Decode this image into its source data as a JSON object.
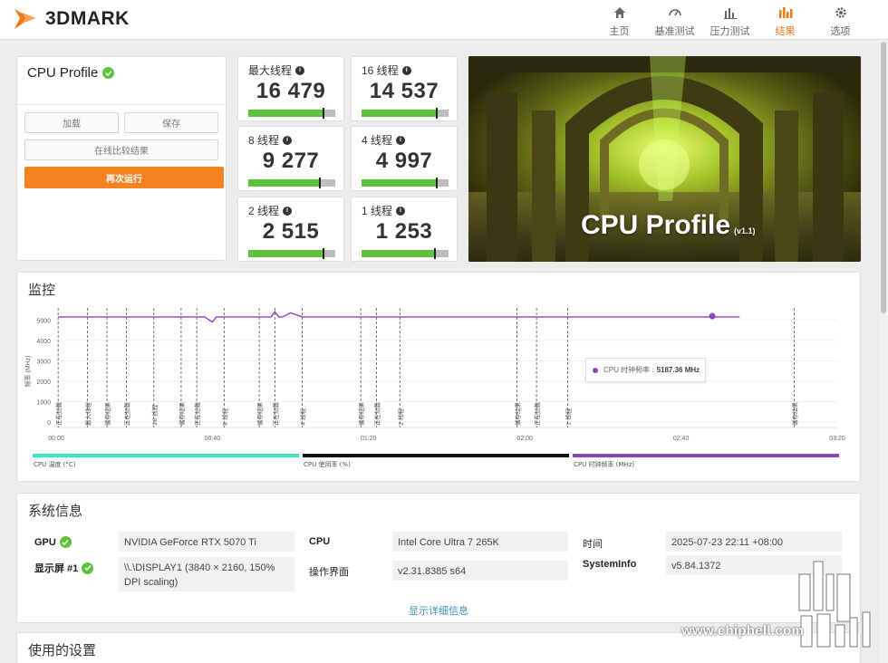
{
  "app": {
    "logo_text": "3DMARK"
  },
  "nav": [
    {
      "label": "主页",
      "icon": "home-icon"
    },
    {
      "label": "基准测试",
      "icon": "gauge-icon"
    },
    {
      "label": "压力测试",
      "icon": "bar-chart-icon"
    },
    {
      "label": "结果",
      "icon": "results-icon",
      "active": true
    },
    {
      "label": "选项",
      "icon": "gear-icon"
    }
  ],
  "profile": {
    "title": "CPU Profile",
    "load_label": "加载",
    "save_label": "保存",
    "compare_label": "在线比较结果",
    "rerun_label": "再次运行"
  },
  "scores": [
    {
      "label": "最大线程",
      "value": "16 479",
      "fill": 0.86
    },
    {
      "label": "16 线程",
      "value": "14 537",
      "fill": 0.86
    },
    {
      "label": "8 线程",
      "value": "9 277",
      "fill": 0.82
    },
    {
      "label": "4 线程",
      "value": "4 997",
      "fill": 0.86
    },
    {
      "label": "2 线程",
      "value": "2 515",
      "fill": 0.86
    },
    {
      "label": "1 线程",
      "value": "1 253",
      "fill": 0.84
    }
  ],
  "hero": {
    "title": "CPU Profile",
    "version": "(v1.1)"
  },
  "monitor": {
    "title": "监控",
    "tooltip_label": "CPU 时钟频率 :",
    "tooltip_value": "5187.36 MHz",
    "legend": [
      {
        "label": "CPU 温度 (°C)",
        "color": "#3ee6c1"
      },
      {
        "label": "CPU 使用率 (%)",
        "color": "#111111"
      },
      {
        "label": "CPU 时钟频率 (MHz)",
        "color": "#8a45c2"
      }
    ]
  },
  "chart_data": {
    "type": "line",
    "ylabel": "频率 (MHz)",
    "ylim": [
      0,
      5500
    ],
    "yticks": [
      0,
      1000,
      2000,
      3000,
      4000,
      5000
    ],
    "xlim": [
      0,
      200
    ],
    "xticks": [
      "00:00",
      "00:40",
      "01:20",
      "02:00",
      "02:40",
      "03:20"
    ],
    "series": [
      {
        "name": "CPU 时钟频率 (MHz)",
        "x": [
          0.5,
          6,
          12,
          18,
          25,
          33,
          38,
          40,
          41,
          43,
          52,
          55,
          56,
          57,
          58,
          60,
          63,
          79,
          82,
          88,
          101,
          116,
          119,
          127,
          131,
          142,
          143,
          152,
          158,
          153,
          156,
          165,
          175
        ],
        "y": [
          5150,
          5150,
          5150,
          5150,
          5150,
          5150,
          5150,
          4900,
          5150,
          5150,
          5150,
          5150,
          5400,
          5150,
          5150,
          5350,
          5150,
          5150,
          5150,
          5150,
          5150,
          5150,
          5150,
          5150,
          5150,
          5150,
          5150,
          5150,
          5150,
          5150,
          5150,
          5150,
          5150
        ]
      }
    ],
    "markers": [
      {
        "x": 0.5,
        "label": "正在加载"
      },
      {
        "x": 8,
        "label": "最大线程"
      },
      {
        "x": 13,
        "label": "储存结果"
      },
      {
        "x": 18,
        "label": "正在加载"
      },
      {
        "x": 25,
        "label": "16 线程"
      },
      {
        "x": 32,
        "label": "储存结果"
      },
      {
        "x": 36,
        "label": "正在加载"
      },
      {
        "x": 43,
        "label": "8 线程"
      },
      {
        "x": 52,
        "label": "储存结果"
      },
      {
        "x": 56,
        "label": "正在加载"
      },
      {
        "x": 63,
        "label": "4 线程"
      },
      {
        "x": 78,
        "label": "储存结果"
      },
      {
        "x": 82,
        "label": "正在加载"
      },
      {
        "x": 88,
        "label": "2 线程"
      },
      {
        "x": 118,
        "label": "储存结果"
      },
      {
        "x": 123,
        "label": "正在加载"
      },
      {
        "x": 131,
        "label": "1 线程"
      },
      {
        "x": 189,
        "label": "储存结果"
      }
    ],
    "highlight_point": {
      "x": 168,
      "y": 5187.36
    }
  },
  "sysinfo": {
    "title": "系统信息",
    "gpu_key": "GPU",
    "gpu_val": "NVIDIA GeForce RTX 5070 Ti",
    "display_key": "显示屏 #1",
    "display_val": "\\\\.\\DISPLAY1 (3840 × 2160, 150% DPI scaling)",
    "cpu_key": "CPU",
    "cpu_val": "Intel Core Ultra 7 265K",
    "ui_key": "操作界面",
    "ui_val": "v2.31.8385 s64",
    "time_key": "时间",
    "time_val": "2025-07-23 22:11 +08:00",
    "sysinfo_key": "SystemInfo",
    "sysinfo_val": "v5.84.1372",
    "details_link": "显示详细信息"
  },
  "settings": {
    "title": "使用的设置"
  },
  "watermark": {
    "text": "www.chiphell.com",
    "logo_text": "chip hell"
  }
}
